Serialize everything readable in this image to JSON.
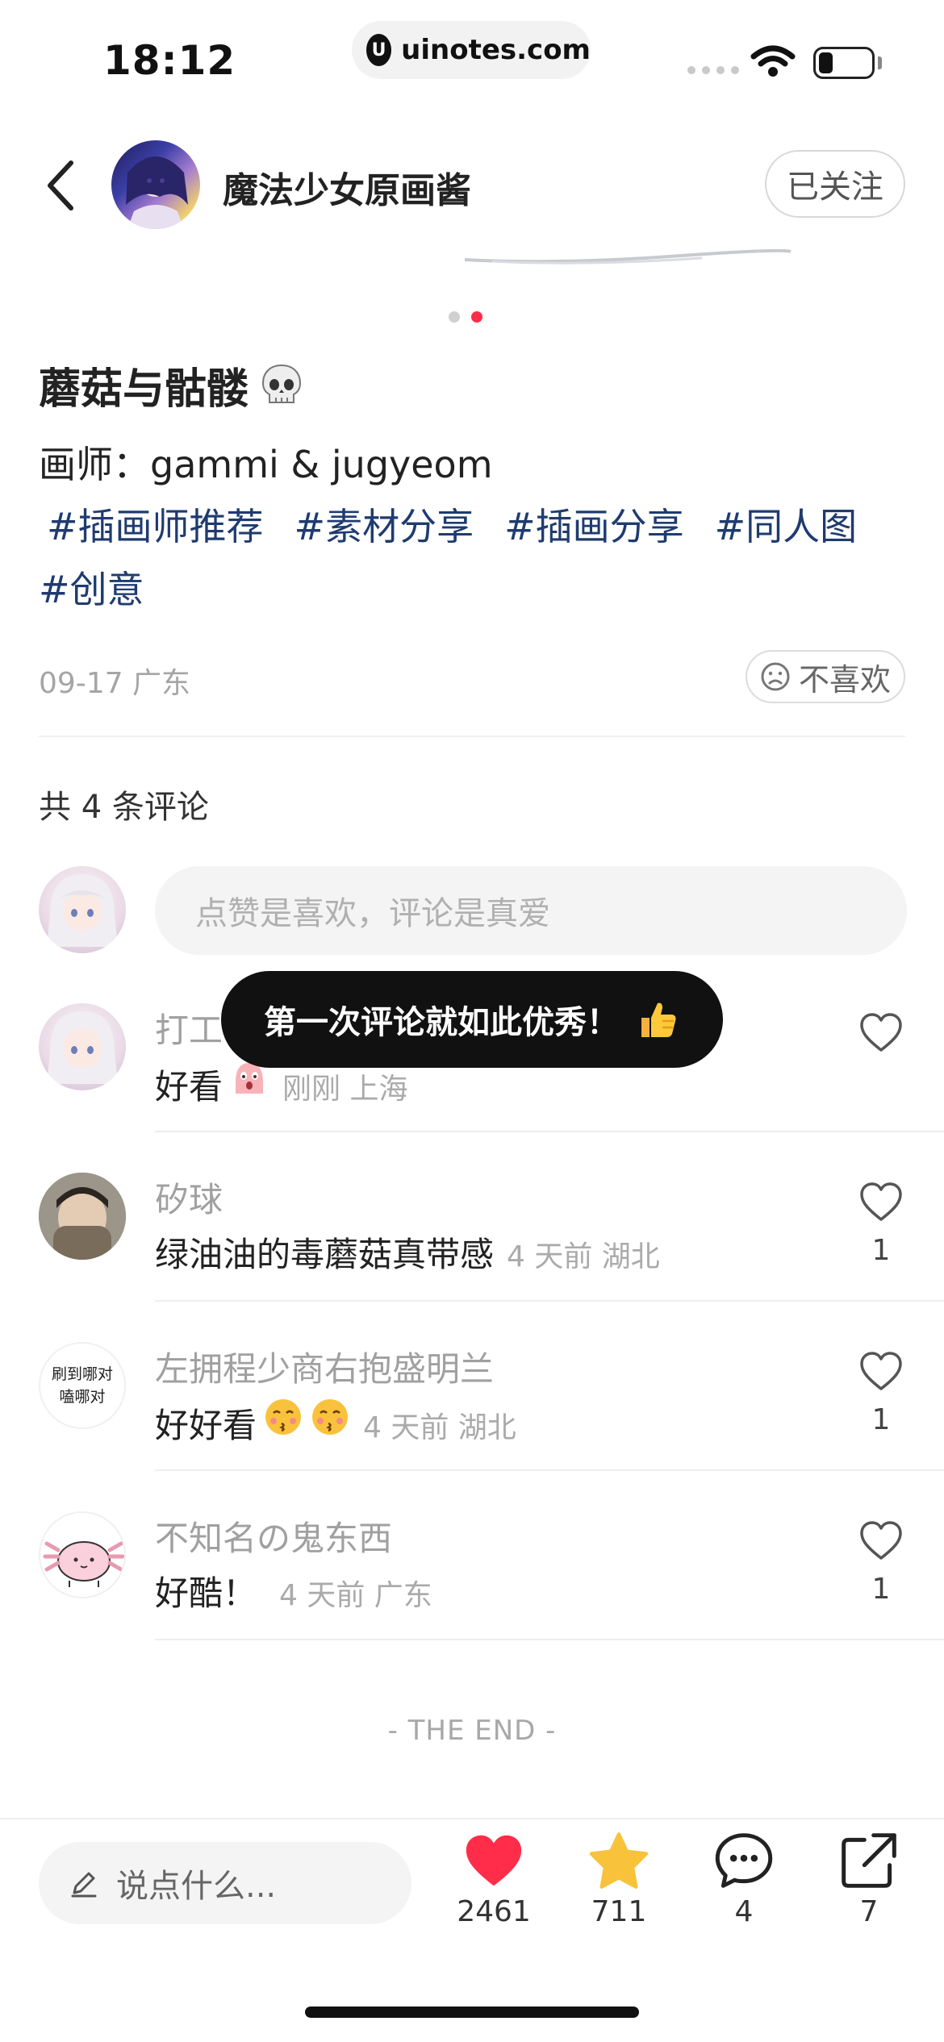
{
  "status_bar": {
    "time": "18:12",
    "url": "uinotes.com"
  },
  "header": {
    "author_name": "魔法少女原画酱",
    "follow_label": "已关注"
  },
  "carousel": {
    "count": 2,
    "active_index": 1
  },
  "post": {
    "title": "蘑菇与骷髅",
    "artist_line": "画师：gammi & jugyeom",
    "tags": [
      "#插画师推荐",
      "#素材分享",
      "#插画分享",
      "#同人图",
      "#创意"
    ],
    "date_location": "09-17 广东",
    "dislike_label": "不喜欢"
  },
  "comments_section": {
    "count_label": "共 4 条评论",
    "input_placeholder": "点赞是喜欢，评论是真爱",
    "items": [
      {
        "user": "打工",
        "text": "好看",
        "time": "刚刚 上海",
        "likes": ""
      },
      {
        "user": "矽球",
        "text": "绿油油的毒蘑菇真带感",
        "time": "4 天前 湖北",
        "likes": "1"
      },
      {
        "user": "左拥程少商右抱盛明兰",
        "text": "好好看",
        "time": "4 天前 湖北",
        "likes": "1",
        "avatar_text": [
          "刷到哪对",
          "嗑哪对"
        ]
      },
      {
        "user": "不知名の鬼东西",
        "text": "好酷！",
        "time": "4 天前 广东",
        "likes": "1"
      }
    ],
    "end_label": "- THE END -"
  },
  "toast": {
    "message": "第一次评论就如此优秀！"
  },
  "bottom_bar": {
    "input_placeholder": "说点什么...",
    "likes": "2461",
    "collects": "711",
    "comments": "4",
    "shares": "7"
  },
  "colors": {
    "accent_red": "#ff2d49",
    "star_yellow": "#f8c23a",
    "tag_blue": "#1f3b6f"
  }
}
